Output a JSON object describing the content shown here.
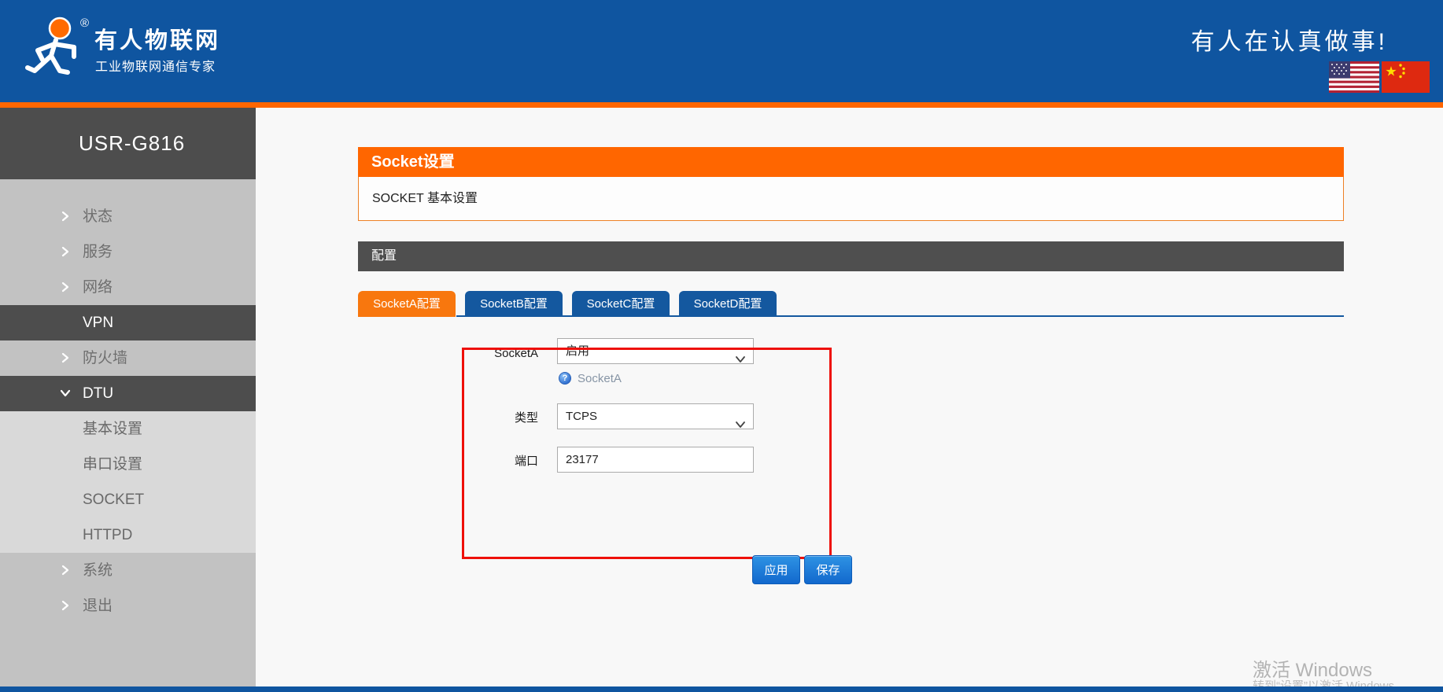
{
  "header": {
    "brand_title": "有人物联网",
    "brand_subtitle": "工业物联网通信专家",
    "slogan": "有人在认真做事!",
    "registered_mark": "®"
  },
  "sidebar": {
    "device_model": "USR-G816",
    "items": [
      {
        "label": "状态",
        "chevron": "right",
        "variant": "base"
      },
      {
        "label": "服务",
        "chevron": "right",
        "variant": "base"
      },
      {
        "label": "网络",
        "chevron": "right",
        "variant": "base"
      },
      {
        "label": "VPN",
        "chevron": "none",
        "variant": "dark"
      },
      {
        "label": "防火墙",
        "chevron": "right",
        "variant": "base"
      },
      {
        "label": "DTU",
        "chevron": "down",
        "variant": "dark"
      },
      {
        "label": "基本设置",
        "chevron": "none",
        "variant": "sub"
      },
      {
        "label": "串口设置",
        "chevron": "none",
        "variant": "sub"
      },
      {
        "label": "SOCKET",
        "chevron": "none",
        "variant": "sub"
      },
      {
        "label": "HTTPD",
        "chevron": "none",
        "variant": "sub"
      },
      {
        "label": "系统",
        "chevron": "right",
        "variant": "base"
      },
      {
        "label": "退出",
        "chevron": "right",
        "variant": "base"
      }
    ]
  },
  "main": {
    "page_header": "Socket设置",
    "page_subheader": "SOCKET 基本设置",
    "section_bar": "配置",
    "tabs": [
      {
        "label": "SocketA配置",
        "active": true
      },
      {
        "label": "SocketB配置",
        "active": false
      },
      {
        "label": "SocketC配置",
        "active": false
      },
      {
        "label": "SocketD配置",
        "active": false
      }
    ],
    "form": {
      "fields": [
        {
          "label": "SocketA",
          "control": "select",
          "value": "启用",
          "help": "SocketA"
        },
        {
          "label": "类型",
          "control": "select",
          "value": "TCPS"
        },
        {
          "label": "端口",
          "control": "input",
          "value": "23177"
        }
      ],
      "apply_label": "应用",
      "save_label": "保存"
    }
  },
  "watermark": {
    "line1": "激活 Windows",
    "line2": "转到“设置”以激活 Windows。"
  },
  "icons": {
    "help_glyph": "?",
    "us_flag": "us-flag",
    "cn_flag": "cn-flag"
  },
  "colors": {
    "header_blue": "#0f55a0",
    "accent_orange": "#ff6600",
    "tab_blue": "#14589f",
    "active_tab_orange": "#f8770e",
    "button_blue": "#1268cd",
    "annotation_red": "#ee100a",
    "sidebar_gray": "#c2c2c2",
    "sidebar_dark": "#4d4d4d",
    "sidebar_sub_gray": "#d9d9d9"
  }
}
